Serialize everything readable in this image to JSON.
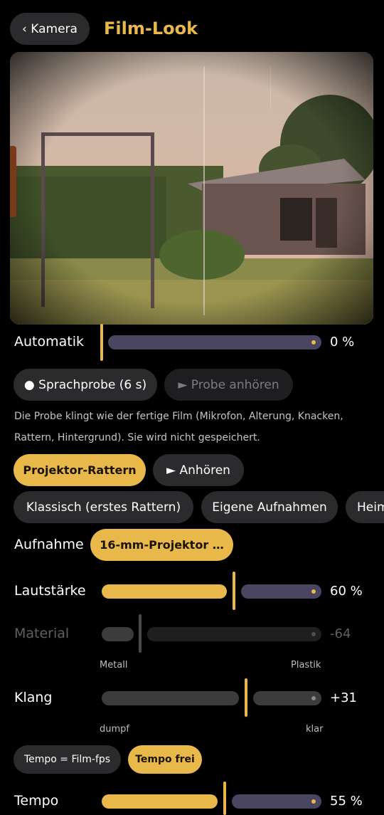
{
  "header": {
    "back_label": "‹ Kamera",
    "title": "Film-Look"
  },
  "automatik": {
    "label": "Automatik",
    "value": "0 %",
    "level": 0
  },
  "sample": {
    "record_label": "● Sprachprobe (6 s)",
    "play_label": "► Probe anhören",
    "hint_line1": "Die Probe klingt wie der fertige Film (Mikrofon, Alterung, Knacken,",
    "hint_line2": "Rattern, Hintergrund). Sie wird nicht gespeichert."
  },
  "sound": {
    "selected_label": "Projektor-Rattern",
    "listen_label": "► Anhören",
    "chips": [
      "Klassisch (erstes Rattern)",
      "Eigene Aufnahmen",
      "Heim"
    ]
  },
  "recording": {
    "label": "Aufnahme",
    "value": "16-mm-Projektor …"
  },
  "volume": {
    "label": "Lautstärke",
    "value": "60 %",
    "level": 0.6
  },
  "material": {
    "label": "Material",
    "value": "-64",
    "min_label": "Metall",
    "max_label": "Plastik"
  },
  "klang": {
    "label": "Klang",
    "value": "+31",
    "min_label": "dumpf",
    "max_label": "klar"
  },
  "tempo_mode": {
    "option1": "Tempo = Film-fps",
    "option2": "Tempo frei",
    "selected": "Tempo frei"
  },
  "tempo": {
    "label": "Tempo",
    "value": "55 %",
    "level": 0.55
  },
  "colors": {
    "accent": "#e8b84a",
    "track": "#4a4560",
    "chip": "#2b2b2d"
  }
}
